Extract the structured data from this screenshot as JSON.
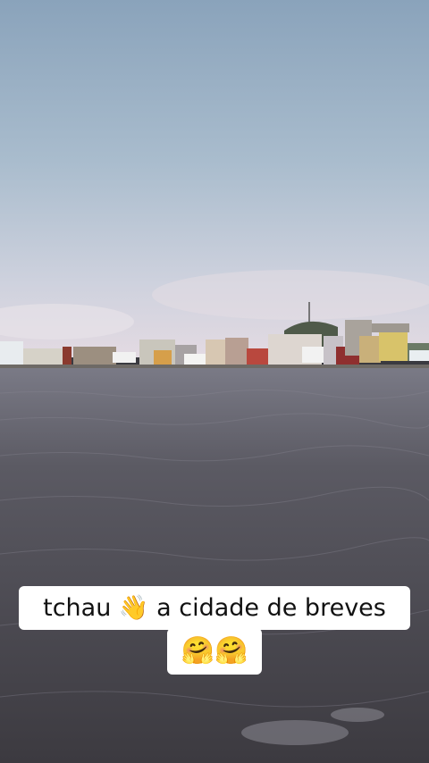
{
  "caption": {
    "line1": "tchau 👋  a cidade de breves",
    "line2": "🤗🤗"
  },
  "colors": {
    "sky_top": "#8ea6bd",
    "sky_horizon": "#ddd6df",
    "water_near": "#3f3d43",
    "water_far": "#6f6f7a",
    "caption_bg": "#ffffff",
    "caption_text": "#111111"
  }
}
